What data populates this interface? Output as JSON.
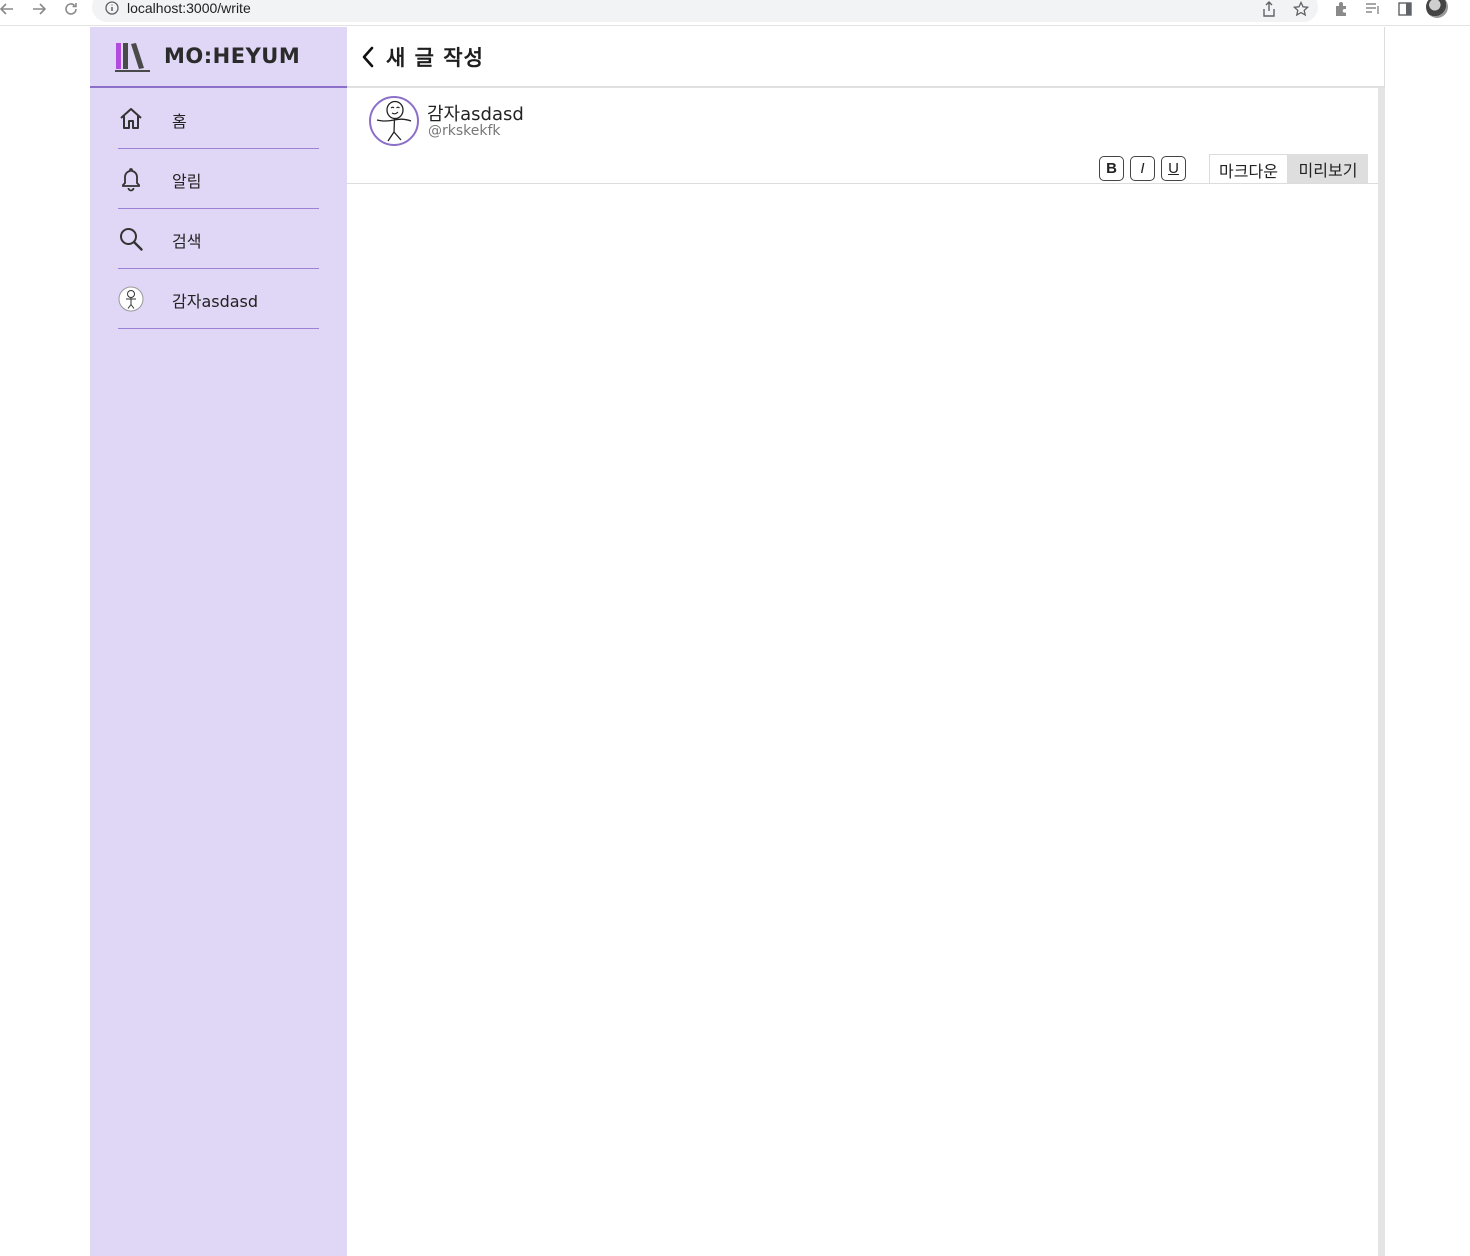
{
  "browser": {
    "url": "localhost:3000/write"
  },
  "brand": {
    "name": "MO:HEYUM",
    "accent": "#8b6fc9",
    "sidebar_bg": "#e0d6f5"
  },
  "sidebar": {
    "items": [
      {
        "label": "홈",
        "icon": "home-icon"
      },
      {
        "label": "알림",
        "icon": "bell-icon"
      },
      {
        "label": "검색",
        "icon": "search-icon"
      },
      {
        "label": "감자asdasd",
        "icon": "avatar-icon"
      }
    ]
  },
  "header": {
    "title": "새 글 작성"
  },
  "author": {
    "name": "감자asdasd",
    "handle": "@rkskekfk"
  },
  "toolbar": {
    "bold": "B",
    "italic": "I",
    "underline": "U",
    "tabs": [
      "마크다운",
      "미리보기"
    ]
  },
  "editor": {
    "value": ""
  }
}
